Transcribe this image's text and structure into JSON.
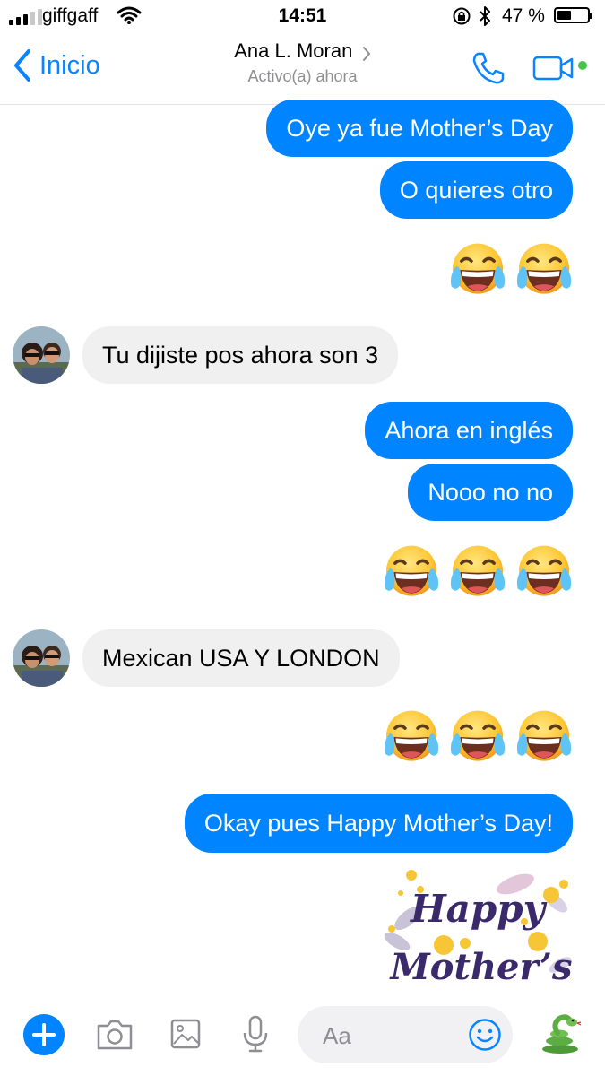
{
  "status_bar": {
    "carrier": "giffgaff",
    "time": "14:51",
    "battery_percent": "47 %",
    "battery_level": 0.47
  },
  "header": {
    "back_label": "Inicio",
    "contact_name": "Ana L. Moran",
    "contact_status": "Activo(a) ahora"
  },
  "messages": [
    {
      "type": "text",
      "direction": "outgoing",
      "text": "Oye ya fue Mother’s Day"
    },
    {
      "type": "text",
      "direction": "outgoing",
      "text": "O quieres otro"
    },
    {
      "type": "emoji",
      "direction": "outgoing",
      "emoji": "face-with-tears-of-joy",
      "count": 2
    },
    {
      "type": "text",
      "direction": "incoming",
      "text": "Tu dijiste pos ahora son 3"
    },
    {
      "type": "text",
      "direction": "outgoing",
      "text": "Ahora en inglés"
    },
    {
      "type": "text",
      "direction": "outgoing",
      "text": "Nooo no no"
    },
    {
      "type": "emoji",
      "direction": "outgoing",
      "emoji": "face-with-tears-of-joy",
      "count": 3
    },
    {
      "type": "text",
      "direction": "incoming",
      "text": "Mexican USA Y LONDON"
    },
    {
      "type": "emoji",
      "direction": "outgoing",
      "emoji": "face-with-tears-of-joy",
      "count": 3
    },
    {
      "type": "text",
      "direction": "outgoing",
      "text": "Okay pues Happy Mother’s Day!"
    },
    {
      "type": "sticker",
      "direction": "outgoing",
      "text_line1": "Happy",
      "text_line2": "Mother’s"
    }
  ],
  "composer": {
    "placeholder": "Aa"
  },
  "colors": {
    "outgoing_bubble": "#0084ff",
    "incoming_bubble": "#f0f0f0",
    "accent": "#0084ff",
    "online": "#44c548"
  },
  "icons": [
    "cellular-signal-icon",
    "wifi-icon",
    "rotation-lock-icon",
    "bluetooth-icon",
    "battery-icon",
    "back-chevron-icon",
    "chevron-right-icon",
    "phone-icon",
    "video-camera-icon",
    "plus-icon",
    "camera-icon",
    "image-icon",
    "microphone-icon",
    "emoji-icon",
    "snake-icon"
  ]
}
